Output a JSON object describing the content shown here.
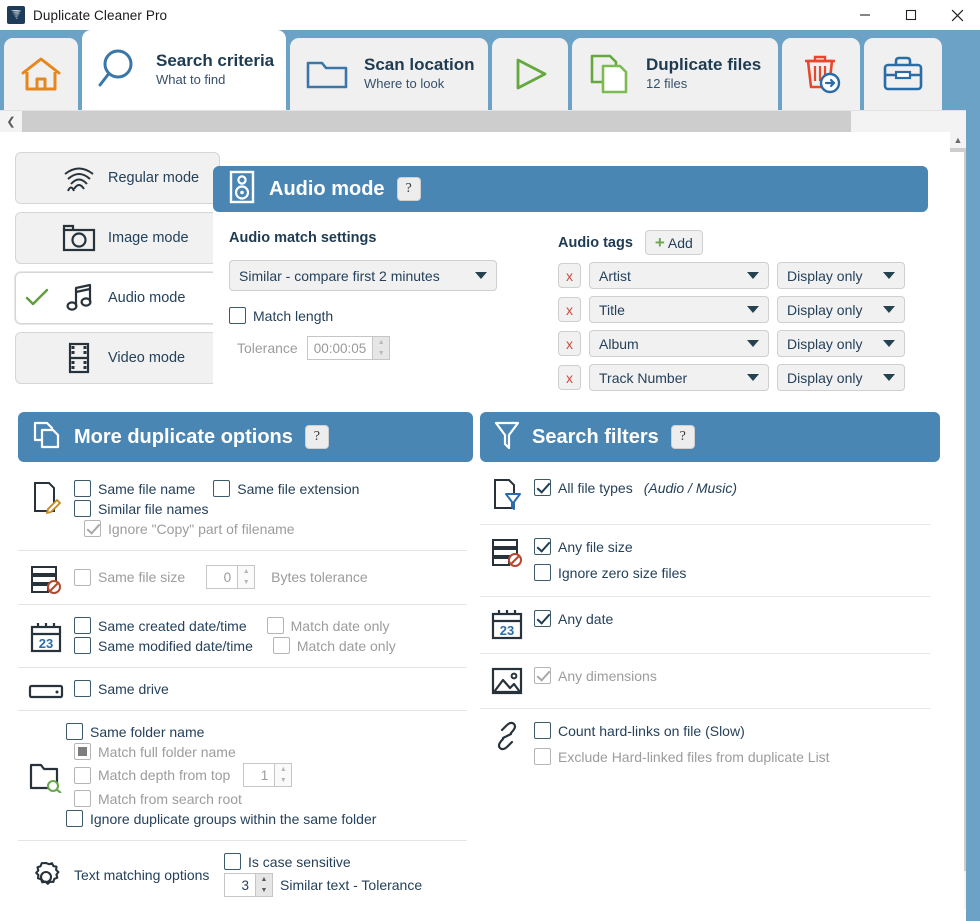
{
  "window": {
    "title": "Duplicate Cleaner Pro",
    "app_icon": "tornado-icon",
    "minimize": "minimize-icon",
    "maximize": "maximize-icon",
    "close": "close-icon"
  },
  "tabs": [
    {
      "icon": "home-icon",
      "title": "",
      "sub": "",
      "active": false
    },
    {
      "icon": "magnifier-icon",
      "title": "Search criteria",
      "sub": "What to find",
      "active": true
    },
    {
      "icon": "folder-icon",
      "title": "Scan location",
      "sub": "Where to look",
      "active": false
    },
    {
      "icon": "play-triangle-icon",
      "title": "",
      "sub": "",
      "active": false
    },
    {
      "icon": "copy-files-icon",
      "title": "Duplicate files",
      "sub": "12 files",
      "active": false
    },
    {
      "icon": "trash-arrow-icon",
      "title": "",
      "sub": "",
      "active": false
    },
    {
      "icon": "toolbox-icon",
      "title": "",
      "sub": "",
      "active": false
    }
  ],
  "scroll": {
    "left_arrow": "chevron-left-icon",
    "right_arrow": "chevron-right-icon",
    "up_arrow": "chevron-up-icon",
    "down_arrow": "chevron-down-icon"
  },
  "modes": [
    {
      "label": "Regular mode",
      "icon": "fingerprint-icon",
      "selected": false
    },
    {
      "label": "Image mode",
      "icon": "camera-icon",
      "selected": false
    },
    {
      "label": "Audio mode",
      "icon": "music-note-icon",
      "selected": true
    },
    {
      "label": "Video mode",
      "icon": "film-strip-icon",
      "selected": false
    }
  ],
  "audio_panel": {
    "header_title": "Audio mode",
    "header_icon": "speaker-icon",
    "help_label": "?",
    "match_settings_title": "Audio match settings",
    "match_mode_value": "Similar - compare first 2 minutes",
    "match_length_label": "Match length",
    "match_length_checked": false,
    "tolerance_label": "Tolerance",
    "tolerance_value": "00:00:05",
    "tags_title": "Audio tags",
    "add_label": "Add",
    "tag_rows": [
      {
        "remove": "x",
        "tag": "Artist",
        "action": "Display only"
      },
      {
        "remove": "x",
        "tag": "Title",
        "action": "Display only"
      },
      {
        "remove": "x",
        "tag": "Album",
        "action": "Display only"
      },
      {
        "remove": "x",
        "tag": "Track Number",
        "action": "Display only"
      }
    ]
  },
  "more_options": {
    "header_title": "More duplicate options",
    "header_icon": "copy-files-icon",
    "help_label": "?",
    "filename_group": {
      "icon": "file-pencil-icon",
      "same_file_name": "Same file name",
      "same_file_name_checked": false,
      "same_file_extension": "Same file extension",
      "same_file_extension_checked": false,
      "similar_file_names": "Similar file names",
      "similar_file_names_checked": false,
      "ignore_copy": "Ignore \"Copy\" part of filename",
      "ignore_copy_checked": true,
      "ignore_copy_disabled": true
    },
    "filesize_group": {
      "icon": "file-size-icon",
      "same_file_size": "Same file size",
      "same_file_size_checked": false,
      "bytes_value": "0",
      "bytes_tolerance": "Bytes tolerance",
      "disabled": true
    },
    "date_group": {
      "icon": "calendar-23-icon",
      "same_created": "Same created date/time",
      "same_created_checked": false,
      "match_date_only_created": "Match date only",
      "match_date_only_created_checked": false,
      "same_modified": "Same modified date/time",
      "same_modified_checked": false,
      "match_date_only_modified": "Match date only",
      "match_date_only_modified_checked": false
    },
    "drive_group": {
      "icon": "drive-icon",
      "same_drive": "Same drive",
      "same_drive_checked": false
    },
    "folder_group": {
      "icon": "folder-search-icon",
      "same_folder_name": "Same folder name",
      "same_folder_name_checked": false,
      "match_full_folder_name": "Match full folder name",
      "match_full_folder_name_selected": true,
      "match_depth_from_top": "Match depth from top",
      "match_depth_checked": false,
      "depth_value": "1",
      "match_from_search_root": "Match from search root",
      "match_from_search_root_checked": false,
      "ignore_dupe_groups": "Ignore duplicate groups within the same folder",
      "ignore_dupe_groups_checked": false
    },
    "text_group": {
      "icon": "gear-icon",
      "label": "Text matching options",
      "is_case_sensitive": "Is case sensitive",
      "is_case_sensitive_checked": false,
      "similar_text_value": "3",
      "similar_text_label": "Similar text - Tolerance"
    }
  },
  "search_filters": {
    "header_title": "Search filters",
    "header_icon": "funnel-icon",
    "help_label": "?",
    "groups": [
      {
        "icon": "file-filter-icon",
        "items": [
          {
            "label": "All file types",
            "note": "(Audio / Music)",
            "checked": true,
            "disabled": false,
            "indent": 0
          }
        ]
      },
      {
        "icon": "file-size-icon",
        "items": [
          {
            "label": "Any file size",
            "note": "",
            "checked": true,
            "disabled": false,
            "indent": 0
          },
          {
            "label": "Ignore zero size files",
            "note": "",
            "checked": false,
            "disabled": false,
            "indent": 1
          }
        ]
      },
      {
        "icon": "calendar-23-icon",
        "items": [
          {
            "label": "Any date",
            "note": "",
            "checked": true,
            "disabled": false,
            "indent": 0
          }
        ]
      },
      {
        "icon": "image-icon",
        "items": [
          {
            "label": "Any dimensions",
            "note": "",
            "checked": true,
            "disabled": true,
            "indent": 0
          }
        ]
      },
      {
        "icon": "link-icon",
        "items": [
          {
            "label": "Count hard-links on file (Slow)",
            "note": "",
            "checked": false,
            "disabled": false,
            "indent": 0
          },
          {
            "label": "Exclude Hard-linked files from duplicate List",
            "note": "",
            "checked": false,
            "disabled": true,
            "indent": 1
          }
        ]
      }
    ]
  },
  "colors": {
    "accent_blue": "#4a86b4",
    "strip_blue": "#6ba2c6",
    "text_dark": "#25415a",
    "green": "#6aa84f",
    "red": "#cc4b3c",
    "orange": "#e8861e"
  }
}
